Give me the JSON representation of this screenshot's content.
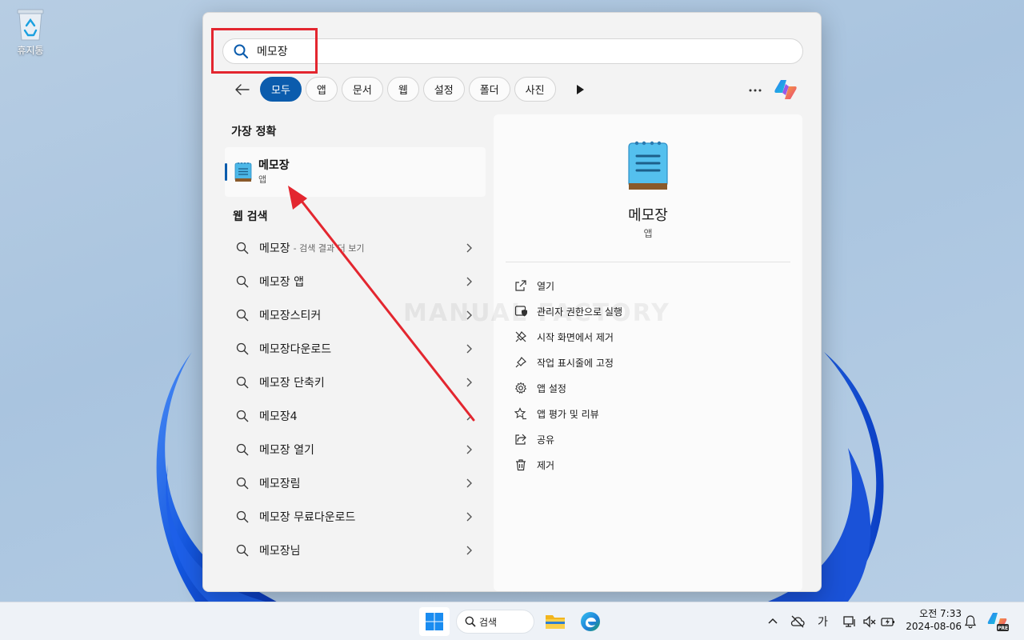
{
  "desktop": {
    "recycle_bin_label": "휴지통"
  },
  "search": {
    "query": "메모장"
  },
  "filters": [
    "모두",
    "앱",
    "문서",
    "웹",
    "설정",
    "폴더",
    "사진"
  ],
  "best_match": {
    "title": "가장 정확",
    "name": "메모장",
    "type": "앱"
  },
  "web_search": {
    "title": "웹 검색",
    "first_hint": "- 검색 결과 더 보기",
    "items": [
      "메모장",
      "메모장 앱",
      "메모장스티커",
      "메모장다운로드",
      "메모장 단축키",
      "메모장4",
      "메모장 열기",
      "메모장림",
      "메모장 무료다운로드",
      "메모장님"
    ]
  },
  "detail": {
    "name": "메모장",
    "type": "앱",
    "actions": [
      "열기",
      "관리자 권한으로 실행",
      "시작 화면에서 제거",
      "작업 표시줄에 고정",
      "앱 설정",
      "앱 평가 및 리뷰",
      "공유",
      "제거"
    ]
  },
  "watermark": "MANUAL FACTORY",
  "taskbar": {
    "search_label": "검색",
    "ime": "가",
    "time": "오전 7:33",
    "date": "2024-08-06"
  },
  "colors": {
    "accent": "#0b5cad",
    "annotation": "#e3262f"
  }
}
